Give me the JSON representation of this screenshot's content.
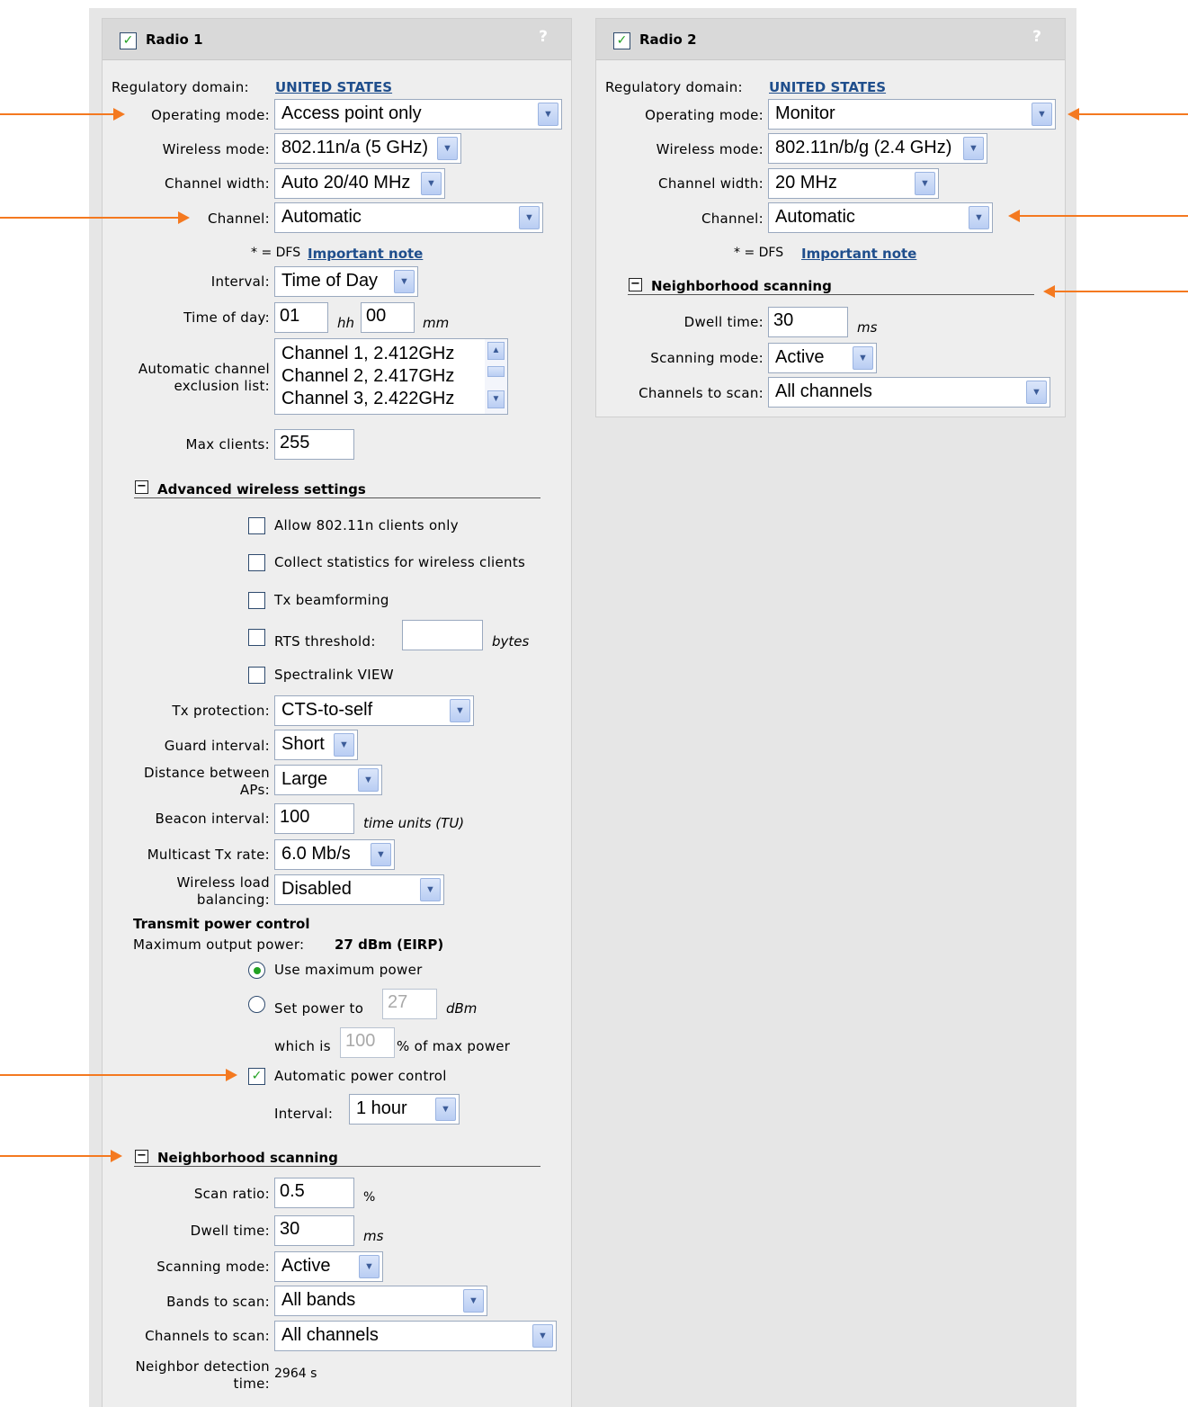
{
  "radio1": {
    "title": "Radio 1",
    "enabled": true,
    "help": "?",
    "regulatory_label": "Regulatory domain:",
    "regulatory_value": "UNITED STATES",
    "operating_mode_label": "Operating mode:",
    "operating_mode": "Access point only",
    "wireless_mode_label": "Wireless mode:",
    "wireless_mode": "802.11n/a (5 GHz)",
    "channel_width_label": "Channel width:",
    "channel_width": "Auto 20/40 MHz",
    "channel_label": "Channel:",
    "channel": "Automatic",
    "dfs_prefix": "* = DFS",
    "dfs_link": "Important note",
    "interval_label": "Interval:",
    "interval": "Time of Day",
    "time_of_day_label": "Time of day:",
    "time_hh": "01",
    "hh_unit": "hh",
    "time_mm": "00",
    "mm_unit": "mm",
    "exclusion_label": "Automatic channel exclusion list:",
    "exclusion_items": [
      "Channel 1, 2.412GHz",
      "Channel 2, 2.417GHz",
      "Channel 3, 2.422GHz"
    ],
    "max_clients_label": "Max clients:",
    "max_clients": "255",
    "advanced": {
      "title": "Advanced wireless settings",
      "allow_n_only": "Allow 802.11n clients only",
      "allow_n_only_checked": false,
      "collect_stats": "Collect statistics for wireless clients",
      "collect_stats_checked": false,
      "tx_beamforming": "Tx beamforming",
      "tx_beamforming_checked": false,
      "rts_label": "RTS threshold:",
      "rts_checked": false,
      "rts_value": "",
      "rts_unit": "bytes",
      "spectralink": "Spectralink VIEW",
      "spectralink_checked": false,
      "tx_protection_label": "Tx protection:",
      "tx_protection": "CTS-to-self",
      "guard_label": "Guard interval:",
      "guard": "Short",
      "distance_label": "Distance between APs:",
      "distance": "Large",
      "beacon_label": "Beacon interval:",
      "beacon": "100",
      "beacon_unit": "time units (TU)",
      "multicast_label": "Multicast Tx rate:",
      "multicast": "6.0 Mb/s",
      "load_balancing_label": "Wireless load balancing:",
      "load_balancing": "Disabled"
    },
    "power": {
      "title": "Transmit power control",
      "max_output_label": "Maximum output power:",
      "max_output_value": "27 dBm (EIRP)",
      "use_max": "Use maximum power",
      "use_max_selected": true,
      "set_power": "Set power to",
      "set_power_value": "27",
      "set_power_unit": "dBm",
      "which_is": "which is",
      "which_is_value": "100",
      "percent_of_max": "% of max power",
      "auto_power": "Automatic power control",
      "auto_power_checked": true,
      "interval_label": "Interval:",
      "interval": "1 hour"
    },
    "neighborhood": {
      "title": "Neighborhood scanning",
      "scan_ratio_label": "Scan ratio:",
      "scan_ratio": "0.5",
      "scan_ratio_unit": "%",
      "dwell_label": "Dwell time:",
      "dwell": "30",
      "dwell_unit": "ms",
      "scanning_mode_label": "Scanning mode:",
      "scanning_mode": "Active",
      "bands_label": "Bands to scan:",
      "bands": "All bands",
      "channels_label": "Channels to scan:",
      "channels": "All channels",
      "detection_label": "Neighbor detection time:",
      "detection_value": "2964 s"
    }
  },
  "radio2": {
    "title": "Radio 2",
    "enabled": true,
    "help": "?",
    "regulatory_label": "Regulatory domain:",
    "regulatory_value": "UNITED STATES",
    "operating_mode_label": "Operating mode:",
    "operating_mode": "Monitor",
    "wireless_mode_label": "Wireless mode:",
    "wireless_mode": "802.11n/b/g (2.4 GHz)",
    "channel_width_label": "Channel width:",
    "channel_width": "20 MHz",
    "channel_label": "Channel:",
    "channel": "Automatic",
    "dfs_prefix": "* = DFS",
    "dfs_link": "Important note",
    "neighborhood": {
      "title": "Neighborhood scanning",
      "dwell_label": "Dwell time:",
      "dwell": "30",
      "dwell_unit": "ms",
      "scanning_mode_label": "Scanning mode:",
      "scanning_mode": "Active",
      "channels_label": "Channels to scan:",
      "channels": "All channels"
    }
  },
  "icons": {
    "check": "✓",
    "dropdown": "▼",
    "scroll_up": "▲",
    "scroll_down": "▼",
    "collapse": "−"
  },
  "colors": {
    "annotation_arrow": "#f47920",
    "link": "#1f4e8c",
    "check": "#21a121"
  }
}
